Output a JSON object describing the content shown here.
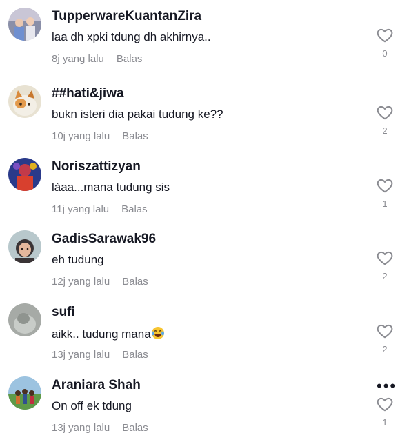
{
  "comments": [
    {
      "username": "TupperwareKuantanZira",
      "text": "laa dh xpki tdung dh akhirnya..",
      "time": "8j yang lalu",
      "reply": "Balas",
      "likes": "0",
      "avatar_icon": "avatar-kids-photo"
    },
    {
      "username": "##hati&jiwa",
      "text": "bukn isteri dia pakai tudung ke??",
      "time": "10j yang lalu",
      "reply": "Balas",
      "likes": "2",
      "avatar_icon": "avatar-cat-photo"
    },
    {
      "username": "Noriszattizyan",
      "text": "làaa...mana tudung sis",
      "time": "11j yang lalu",
      "reply": "Balas",
      "likes": "1",
      "avatar_icon": "avatar-costume-photo"
    },
    {
      "username": "GadisSarawak96",
      "text": "eh tudung",
      "time": "12j yang lalu",
      "reply": "Balas",
      "likes": "2",
      "avatar_icon": "avatar-girl-photo"
    },
    {
      "username": "sufi",
      "text": "aikk.. tudung mana",
      "text_emoji": "laughing-tears-emoji",
      "time": "13j yang lalu",
      "reply": "Balas",
      "likes": "2",
      "avatar_icon": "avatar-grey-photo"
    },
    {
      "username": "Araniara Shah",
      "text": "On off ek tdung",
      "time": "13j yang lalu",
      "reply": "Balas",
      "likes": "1",
      "avatar_icon": "avatar-group-photo",
      "more_icon": "more-dots-icon",
      "more_label": "•••"
    }
  ],
  "colors": {
    "text": "#161823",
    "secondary": "#8a8b91",
    "background": "#ffffff"
  },
  "icons": {
    "like": "heart-outline-icon"
  }
}
